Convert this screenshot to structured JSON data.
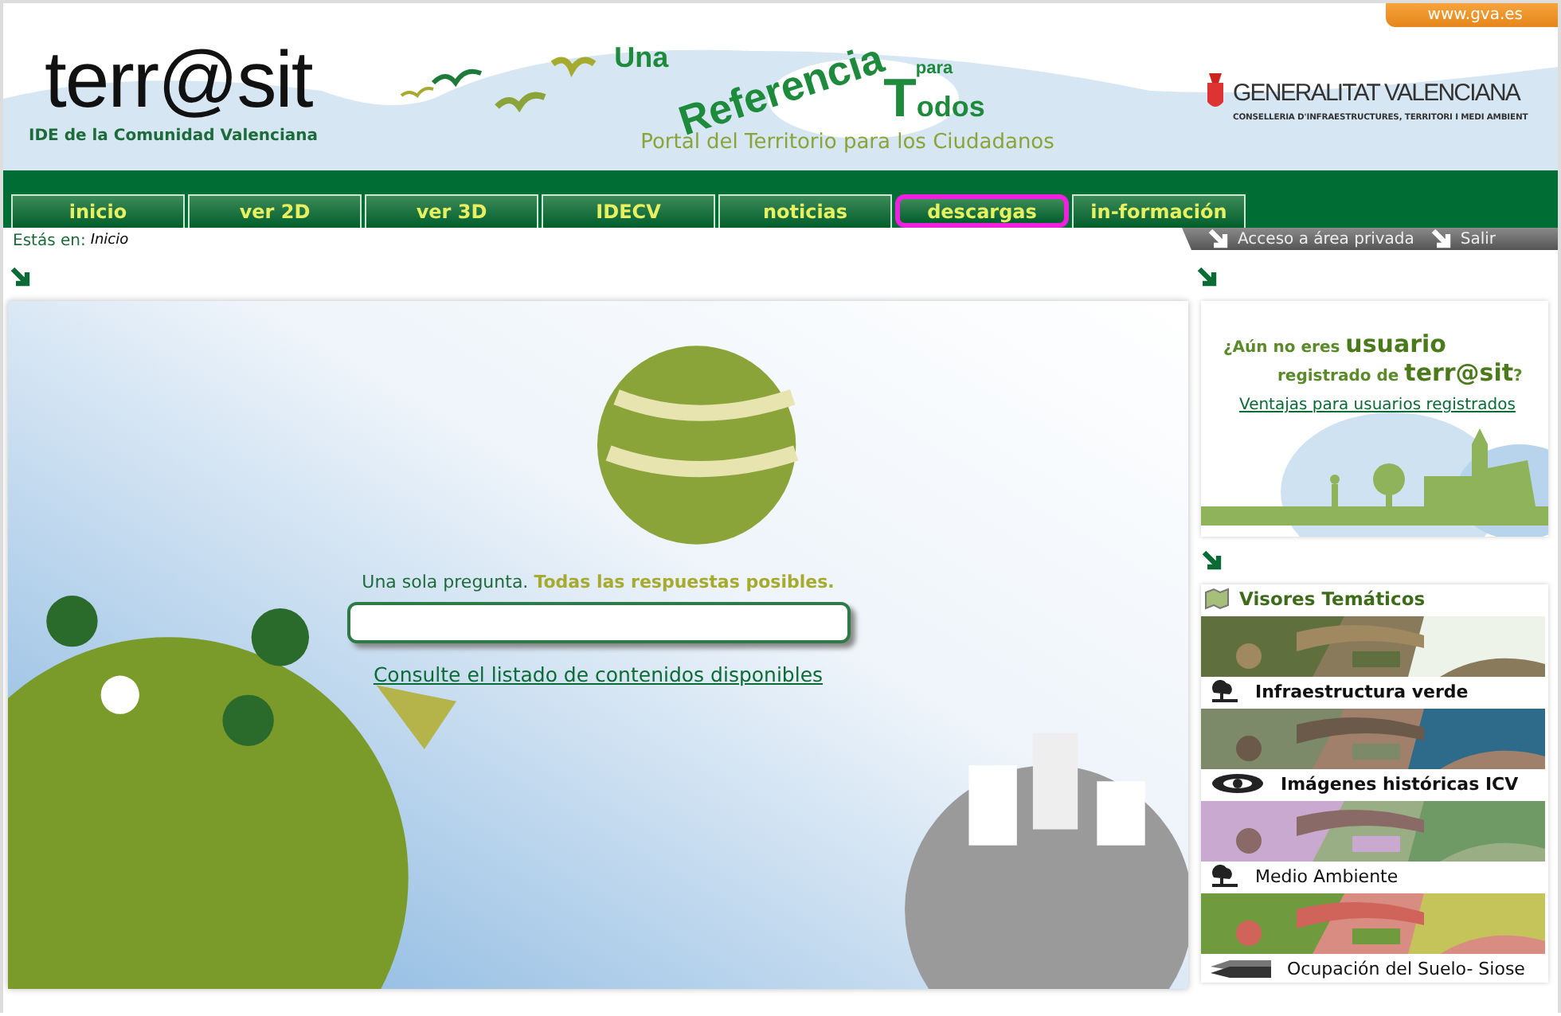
{
  "header": {
    "link": "www.gva.es",
    "logo": {
      "name": "terr@sit",
      "subtitle": "IDE de la Comunidad Valenciana"
    },
    "slogan": {
      "line_1": "Una",
      "line_2": "Referencia",
      "line_3": "para",
      "line_4": "Todos",
      "tagline": "Portal del Territorio para los Ciudadanos"
    },
    "institution": {
      "name": "GENERALITAT VALENCIANA",
      "department": "CONSELLERIA D'INFRAESTRUCTURES, TERRITORI I MEDI AMBIENT"
    }
  },
  "nav": [
    {
      "label": "inicio",
      "highlighted": false
    },
    {
      "label": "ver 2D",
      "highlighted": false
    },
    {
      "label": "ver 3D",
      "highlighted": false
    },
    {
      "label": "IDECV",
      "highlighted": false
    },
    {
      "label": "noticias",
      "highlighted": false
    },
    {
      "label": "descargas",
      "highlighted": true
    },
    {
      "label": "in-formación",
      "highlighted": false
    }
  ],
  "breadcrumb": {
    "label": "Estás en:",
    "current": "Inicio"
  },
  "user_links": [
    "Acceso a área privada",
    "Salir"
  ],
  "search": {
    "prompt": "Una sola pregunta. **Todas las respuestas posibles.**",
    "link": "Consulte el listado de contenidos disponibles"
  },
  "register": {
    "lines": [
      "¿Aún no eres **usuario**",
      "registrado de **terr@sit**?"
    ],
    "link": "Ventajas para usuarios registrados"
  },
  "viewers": {
    "title": "Visores Temáticos",
    "items": [
      {
        "label": "Infraestructura verde",
        "kind": "tree"
      },
      {
        "label": "Imágenes históricas ICV",
        "kind": "eye"
      },
      {
        "label": "Medio Ambiente",
        "kind": "tree"
      },
      {
        "label": "Ocupación del Suelo- Siose",
        "kind": "layers"
      }
    ]
  }
}
